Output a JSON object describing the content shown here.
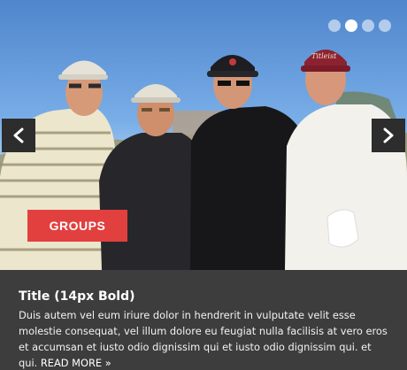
{
  "slide": {
    "badge_label": "GROUPS",
    "title": "Title (14px Bold)",
    "body": "Duis autem vel eum iriure dolor in hendrerit in vulputate velit esse molestie consequat, vel illum dolore eu feugiat nulla facilisis at vero eros et accumsan et iusto odio dignissim qui et iusto odio dignissim qui. et qui. ",
    "read_more": "READ MORE",
    "read_more_glyph": "»"
  },
  "pagination": {
    "total": 4,
    "active": 2
  },
  "navigation": {
    "prev_icon": "chevron-left-icon",
    "next_icon": "chevron-right-icon"
  },
  "photo": {
    "caps": [
      "Titleist"
    ]
  },
  "colors": {
    "accent": "#e2403f",
    "caption_bg": "#3d3d3d",
    "arrow_bg": "#2d2d2d"
  }
}
